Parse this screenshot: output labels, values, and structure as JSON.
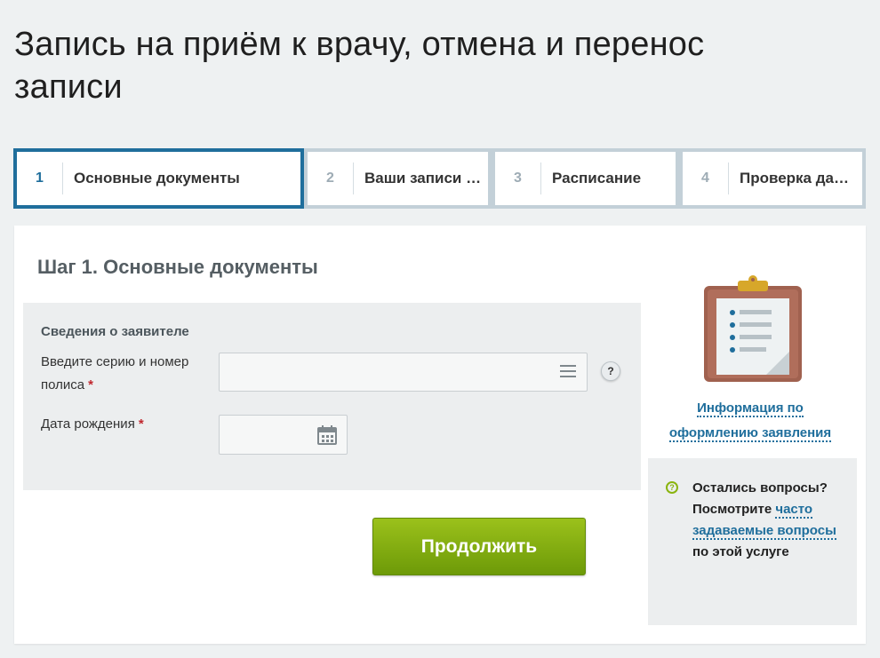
{
  "page": {
    "title": "Запись на приём к врачу, отмена и перенос записи"
  },
  "steps": [
    {
      "number": "1",
      "label": "Основные документы",
      "active": true
    },
    {
      "number": "2",
      "label": "Ваши записи …",
      "active": false
    },
    {
      "number": "3",
      "label": "Расписание",
      "active": false
    },
    {
      "number": "4",
      "label": "Проверка дан…",
      "active": false
    }
  ],
  "form": {
    "heading": "Шаг 1. Основные документы",
    "section_title": "Сведения о заявителе",
    "policy_label": "Введите серию и номер полиса",
    "policy_value": "",
    "birthdate_label": "Дата рождения",
    "birthdate_value": "",
    "required_mark": "*",
    "help_label": "?",
    "continue_label": "Продолжить"
  },
  "sidebar": {
    "info_link": "Информация по оформлению заявления",
    "faq_prefix": "Остались вопросы? Посмотрите",
    "faq_link": "часто задаваемые вопросы",
    "faq_suffix": "по этой услуге",
    "faq_icon_label": "?"
  },
  "colors": {
    "accent": "#1f6e9c",
    "button_green": "#7fab0f",
    "required": "#c0262d"
  }
}
